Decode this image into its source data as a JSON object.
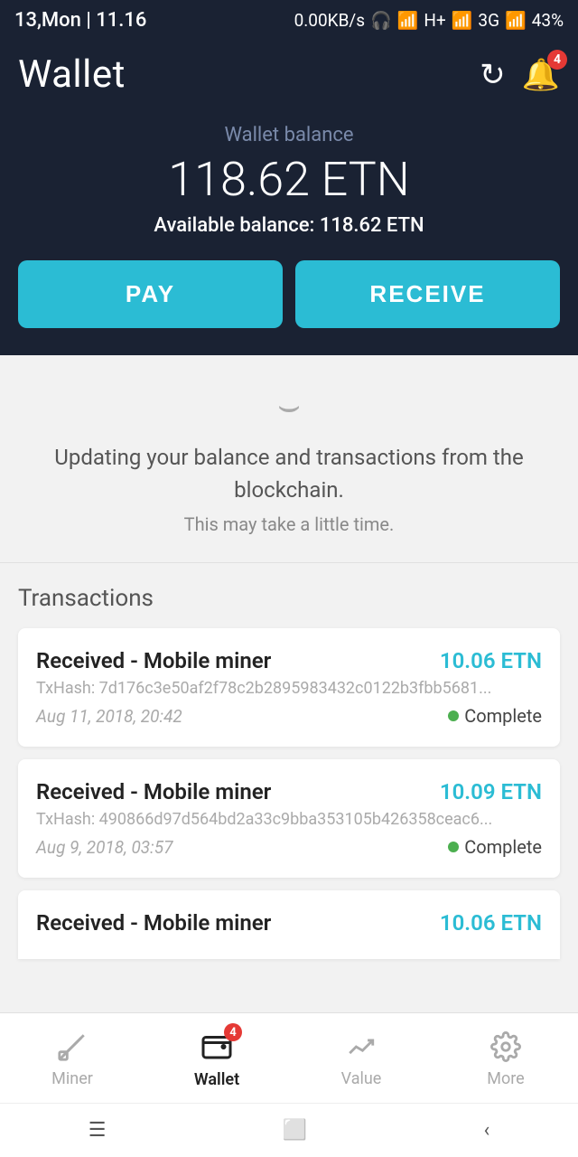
{
  "statusBar": {
    "time": "13,Mon | 11.16",
    "network": "0.00KB/s",
    "signal": "H+",
    "network2": "3G",
    "battery": "43%"
  },
  "header": {
    "title": "Wallet",
    "notifCount": "4"
  },
  "balance": {
    "label": "Wallet balance",
    "amount": "118.62 ETN",
    "availableLabel": "Available balance: 118.62 ETN"
  },
  "buttons": {
    "pay": "PAY",
    "receive": "RECEIVE"
  },
  "updating": {
    "message": "Updating your balance and transactions from the blockchain.",
    "subtext": "This may take a little time."
  },
  "transactions": {
    "title": "Transactions",
    "items": [
      {
        "title": "Received - Mobile miner",
        "amount": "10.06 ETN",
        "hash": "TxHash: 7d176c3e50af2f78c2b2895983432c0122b3fbb5681...",
        "date": "Aug 11, 2018, 20:42",
        "status": "Complete"
      },
      {
        "title": "Received - Mobile miner",
        "amount": "10.09 ETN",
        "hash": "TxHash: 490866d97d564bd2a33c9bba353105b426358ceac6...",
        "date": "Aug 9, 2018, 03:57",
        "status": "Complete"
      },
      {
        "title": "Received - Mobile miner",
        "amount": "10.06 ETN",
        "hash": "",
        "date": "",
        "status": ""
      }
    ]
  },
  "bottomNav": {
    "items": [
      {
        "label": "Miner",
        "icon": "⛏",
        "active": false
      },
      {
        "label": "Wallet",
        "icon": "💼",
        "active": true,
        "badge": "4"
      },
      {
        "label": "Value",
        "icon": "📈",
        "active": false
      },
      {
        "label": "More",
        "icon": "⚙",
        "active": false
      }
    ]
  },
  "systemNav": {
    "menu": "☰",
    "home": "⬜",
    "back": "‹"
  }
}
